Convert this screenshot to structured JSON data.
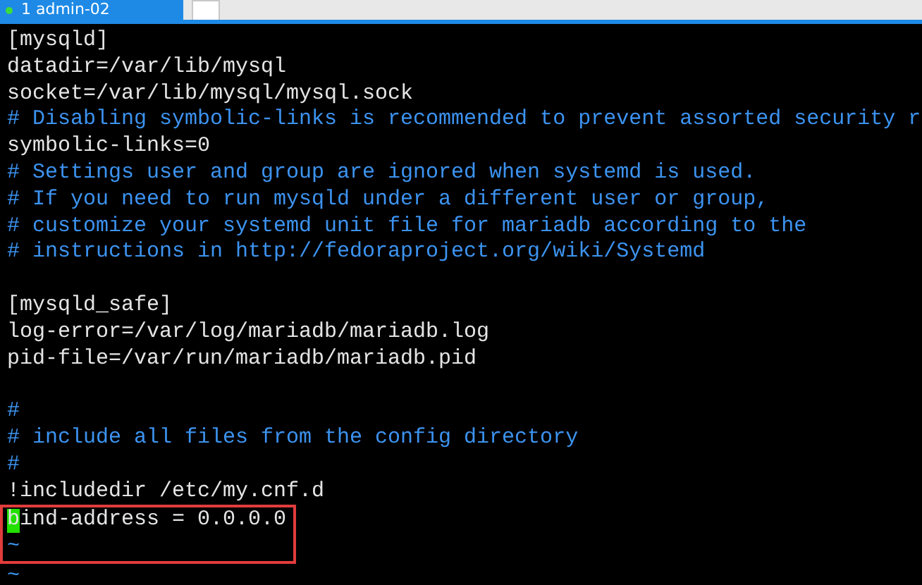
{
  "tabs": [
    {
      "label": "1 admin-02",
      "selected": true
    },
    {
      "selected": false
    }
  ],
  "editor": {
    "lines": [
      {
        "kind": "text",
        "text": "[mysqld]"
      },
      {
        "kind": "text",
        "text": "datadir=/var/lib/mysql"
      },
      {
        "kind": "text",
        "text": "socket=/var/lib/mysql/mysql.sock"
      },
      {
        "kind": "comment",
        "text": "# Disabling symbolic-links is recommended to prevent assorted security r"
      },
      {
        "kind": "text",
        "text": "symbolic-links=0"
      },
      {
        "kind": "comment",
        "text": "# Settings user and group are ignored when systemd is used."
      },
      {
        "kind": "comment",
        "text": "# If you need to run mysqld under a different user or group,"
      },
      {
        "kind": "comment",
        "text": "# customize your systemd unit file for mariadb according to the"
      },
      {
        "kind": "comment",
        "text": "# instructions in http://fedoraproject.org/wiki/Systemd"
      },
      {
        "kind": "blank"
      },
      {
        "kind": "text",
        "text": "[mysqld_safe]"
      },
      {
        "kind": "text",
        "text": "log-error=/var/log/mariadb/mariadb.log"
      },
      {
        "kind": "text",
        "text": "pid-file=/var/run/mariadb/mariadb.pid"
      },
      {
        "kind": "blank"
      },
      {
        "kind": "comment",
        "text": "#"
      },
      {
        "kind": "comment",
        "text": "# include all files from the config directory"
      },
      {
        "kind": "comment",
        "text": "#"
      },
      {
        "kind": "text",
        "text": "!includedir /etc/my.cnf.d"
      }
    ],
    "highlighted_lines": [
      {
        "kind": "text",
        "text": "bind-address = 0.0.0.0",
        "cursor": true
      },
      {
        "kind": "tilde",
        "text": "~",
        "cursor": false
      }
    ],
    "after_lines": [
      {
        "kind": "tilde",
        "text": "~"
      }
    ]
  }
}
